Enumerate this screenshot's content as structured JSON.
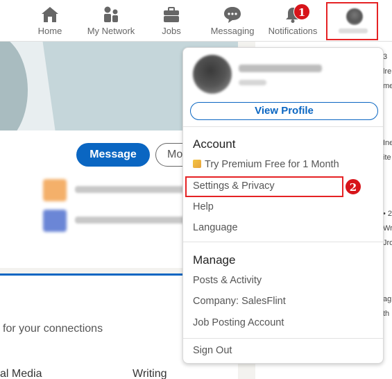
{
  "nav": {
    "items": [
      {
        "label": "Home",
        "icon": "home-icon"
      },
      {
        "label": "My Network",
        "icon": "people-icon"
      },
      {
        "label": "Jobs",
        "icon": "briefcase-icon"
      },
      {
        "label": "Messaging",
        "icon": "chat-bubble-icon"
      },
      {
        "label": "Notifications",
        "icon": "bell-icon"
      }
    ]
  },
  "annotations": {
    "step1": "1",
    "step2": "2",
    "highlight_color": "#e52224"
  },
  "profile": {
    "message_label": "Message",
    "more_label": "Mo"
  },
  "page": {
    "connections_text": "for your connections",
    "skill_a": "al Media",
    "skill_b": "Writing"
  },
  "right_snippets": [
    "3",
    "lre",
    "me",
    "Ine",
    "ite",
    "• 2",
    "Wr",
    "Jro",
    "ag",
    "th"
  ],
  "dropdown": {
    "view_profile": "View Profile",
    "account_heading": "Account",
    "premium_label": "Try Premium Free for 1 Month",
    "settings_label": "Settings & Privacy",
    "help_label": "Help",
    "language_label": "Language",
    "manage_heading": "Manage",
    "posts_label": "Posts & Activity",
    "company_label": "Company: SalesFlint",
    "job_posting_label": "Job Posting Account",
    "sign_out_label": "Sign Out"
  },
  "colors": {
    "brand_blue": "#0a66c2",
    "badge_red": "#d7141a"
  }
}
